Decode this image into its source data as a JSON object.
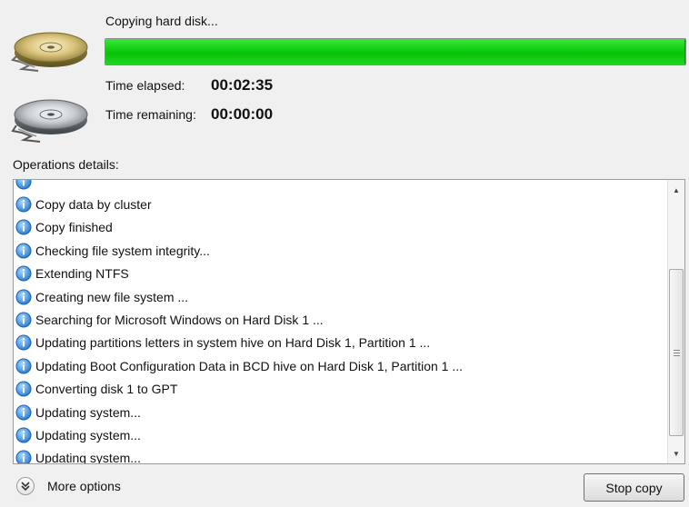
{
  "copy": {
    "title": "Copying hard disk...",
    "progress_percent": 100,
    "progress_color": "#0ecb0e",
    "time_elapsed_label": "Time elapsed:",
    "time_elapsed_value": "00:02:35",
    "time_remaining_label": "Time remaining:",
    "time_remaining_value": "00:00:00",
    "source_disk_icon": "hard-disk-gold-icon",
    "target_disk_icon": "hard-disk-silver-icon"
  },
  "operations": {
    "label": "Operations details:",
    "item_icon": "info-icon",
    "items": [
      "",
      "Copy data by cluster",
      "Copy finished",
      "Checking file system integrity...",
      "Extending NTFS",
      "Creating new file system ...",
      "Searching for Microsoft Windows on Hard Disk 1 ...",
      "Updating partitions letters in system hive on Hard Disk 1, Partition 1 ...",
      "Updating Boot Configuration Data in BCD hive on Hard Disk 1, Partition 1 ...",
      "Converting disk 1 to GPT",
      "Updating system...",
      "Updating system...",
      "Updating system..."
    ]
  },
  "footer": {
    "more_options_label": "More options",
    "more_options_icon": "chevron-double-down-icon",
    "stop_button_label": "Stop copy"
  }
}
